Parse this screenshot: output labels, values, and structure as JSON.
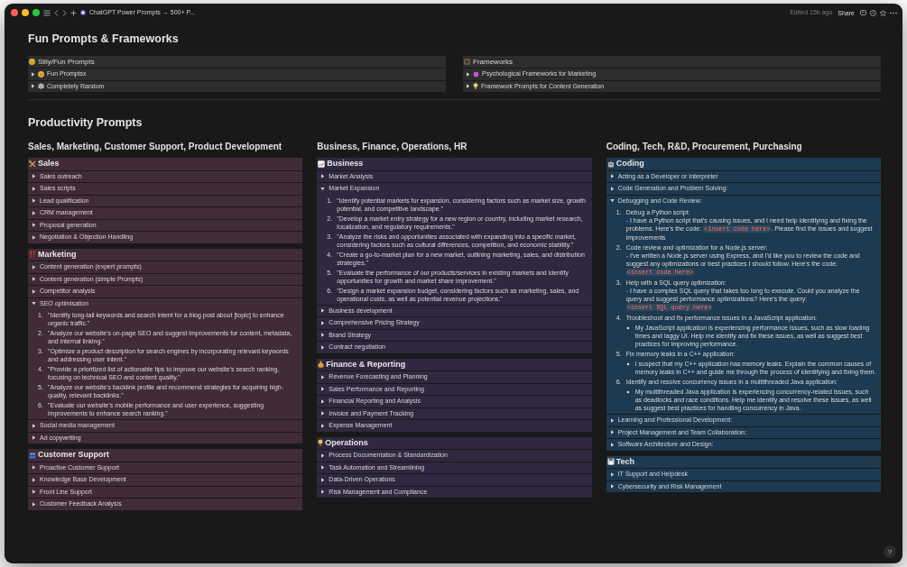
{
  "titlebar": {
    "page_title": "ChatGPT Power Prompts → 500+ P...",
    "edited": "Edited 15h ago",
    "share_label": "Share"
  },
  "fun_section": {
    "heading": "Fun Prompts & Frameworks",
    "boards": [
      {
        "title": "Silly/Fun Prompts",
        "items": [
          {
            "label": "Fun Promptsx",
            "expanded": false
          },
          {
            "label": "Completely Random",
            "expanded": false
          }
        ]
      },
      {
        "title": "Frameworks",
        "items": [
          {
            "label": "Psychological Frameworks for Marketing",
            "expanded": false
          },
          {
            "label": "Framework Prompts for Content Generation",
            "expanded": false
          }
        ]
      }
    ]
  },
  "productivity": {
    "heading": "Productivity Prompts",
    "columns": [
      {
        "heading": "Sales, Marketing, Customer Support, Product Development",
        "color": "#412b39",
        "blocks": [
          {
            "title": "Sales",
            "items": [
              {
                "label": "Sales outreach",
                "expanded": false
              },
              {
                "label": "Sales scripts",
                "expanded": false
              },
              {
                "label": "Lead qualification",
                "expanded": false
              },
              {
                "label": "CRM management",
                "expanded": false
              },
              {
                "label": "Proposal generation",
                "expanded": false
              },
              {
                "label": "Negotiation & Objection Handling",
                "expanded": false
              }
            ]
          },
          {
            "title": "Marketing",
            "items": [
              {
                "label": "Content generation (expert prompts)",
                "expanded": false
              },
              {
                "label": "Content generation (simple Prompts)",
                "expanded": false
              },
              {
                "label": "Competitor analysis",
                "expanded": false
              },
              {
                "label": "SEO optimisation",
                "expanded": true,
                "children": [
                  {
                    "number": "1.",
                    "title": "\"Identify long-tail keywords and search intent for a blog post about [topic] to enhance organic traffic.\""
                  },
                  {
                    "number": "2.",
                    "title": "\"Analyze our website's on-page SEO and suggest improvements for content, metadata, and internal linking.\""
                  },
                  {
                    "number": "3.",
                    "title": "\"Optimize a product description for search engines by incorporating relevant keywords and addressing user intent.\""
                  },
                  {
                    "number": "4.",
                    "title": "\"Provide a prioritized list of actionable tips to improve our website's search ranking, focusing on technical SEO and content quality.\""
                  },
                  {
                    "number": "5.",
                    "title": "\"Analyze our website's backlink profile and recommend strategies for acquiring high-quality, relevant backlinks.\""
                  },
                  {
                    "number": "6.",
                    "title": "\"Evaluate our website's mobile performance and user experience, suggesting improvements to enhance search ranking.\""
                  }
                ]
              },
              {
                "label": "Social media management",
                "expanded": false
              },
              {
                "label": "Ad copywriting",
                "expanded": false
              }
            ]
          },
          {
            "title": "Customer Support",
            "items": [
              {
                "label": "Proactive Customer Support",
                "expanded": false
              },
              {
                "label": "Knowledge Base Development",
                "expanded": false
              },
              {
                "label": "Front Line Support",
                "expanded": false
              },
              {
                "label": "Customer Feedback Analysis",
                "expanded": false
              }
            ]
          }
        ]
      },
      {
        "heading": "Business, Finance, Operations, HR",
        "color": "#2f2840",
        "blocks": [
          {
            "title": "Business",
            "items": [
              {
                "label": "Market Analysis",
                "expanded": false
              },
              {
                "label": "Market Expansion",
                "expanded": true,
                "children": [
                  {
                    "number": "1.",
                    "title": "\"Identify potential markets for expansion, considering factors such as market size, growth potential, and competitive landscape.\""
                  },
                  {
                    "number": "2.",
                    "title": "\"Develop a market entry strategy for a new region or country, including market research, localization, and regulatory requirements.\""
                  },
                  {
                    "number": "3.",
                    "title": "\"Analyze the risks and opportunities associated with expanding into a specific market, considering factors such as cultural differences, competition, and economic stability.\""
                  },
                  {
                    "number": "4.",
                    "title": "\"Create a go-to-market plan for a new market, outlining marketing, sales, and distribution strategies.\""
                  },
                  {
                    "number": "5.",
                    "title": "\"Evaluate the performance of our products/services in existing markets and identify opportunities for growth and market share improvement.\""
                  },
                  {
                    "number": "6.",
                    "title": "\"Design a market expansion budget, considering factors such as marketing, sales, and operational costs, as well as potential revenue projections.\""
                  }
                ]
              },
              {
                "label": "Business development",
                "expanded": false
              },
              {
                "label": "Comprehensive Pricing Strategy",
                "expanded": false
              },
              {
                "label": "Brand Strategy",
                "expanded": false
              },
              {
                "label": "Contract negotiation",
                "expanded": false
              }
            ]
          },
          {
            "title": "Finance & Reporting",
            "items": [
              {
                "label": "Revenue Forecasting and Planning",
                "expanded": false
              },
              {
                "label": "Sales Performance and Reporting",
                "expanded": false
              },
              {
                "label": "Financial Reporting and Analysis",
                "expanded": false
              },
              {
                "label": "Invoice and Payment Tracking",
                "expanded": false
              },
              {
                "label": "Expense Management",
                "expanded": false
              }
            ]
          },
          {
            "title": "Operations",
            "items": [
              {
                "label": "Process Documentation & Standardization",
                "expanded": false
              },
              {
                "label": "Task Automation and Streamlining",
                "expanded": false
              },
              {
                "label": "Data-Driven Operations",
                "expanded": false
              },
              {
                "label": "Risk Management and Compliance",
                "expanded": false
              }
            ]
          }
        ]
      },
      {
        "heading": "Coding, Tech, R&D, Procurement, Purchasing",
        "color": "#1d3a50",
        "blocks": [
          {
            "title": "Coding",
            "items": [
              {
                "label": "Acting as a Developer or Interpreter",
                "expanded": false
              },
              {
                "label": "Code Generation and Problem Solving:",
                "expanded": false
              },
              {
                "label": "Debugging and Code Review:",
                "expanded": true,
                "children": [
                  {
                    "number": "1.",
                    "title": "Debug a Python script:",
                    "body": [
                      {
                        "kind": "text",
                        "text": "- I have a Python script that's causing issues, and I need help identifying and fixing the problems. Here's the code: "
                      },
                      {
                        "kind": "code",
                        "text": "<insert code here>"
                      },
                      {
                        "kind": "text",
                        "text": ". Please find the issues and suggest improvements"
                      }
                    ]
                  },
                  {
                    "number": "2.",
                    "title": "Code review and optimization for a Node.js server:",
                    "body": [
                      {
                        "kind": "text",
                        "text": "- I've written a Node.js server using Express, and I'd like you to review the code and suggest any optimizations or best practices I should follow. Here's the code: "
                      },
                      {
                        "kind": "code",
                        "text": "<insert code here>"
                      }
                    ]
                  },
                  {
                    "number": "3.",
                    "title": "Help with a SQL query optimization:",
                    "body": [
                      {
                        "kind": "text",
                        "text": "- I have a complex SQL query that takes too long to execute. Could you analyze the query and suggest performance optimizations? Here's the query: "
                      },
                      {
                        "kind": "code",
                        "text": "<insert SQL query here>"
                      }
                    ]
                  },
                  {
                    "number": "4.",
                    "title": "Troubleshoot and fix performance issues in a JavaScript application:",
                    "bullets": [
                      "My JavaScript application is experiencing performance issues, such as slow loading times and laggy UI. Help me identify and fix these issues, as well as suggest best practices for improving performance."
                    ]
                  },
                  {
                    "number": "5.",
                    "title": "Fix memory leaks in a C++ application:",
                    "bullets": [
                      "I suspect that my C++ application has memory leaks. Explain the common causes of memory leaks in C++ and guide me through the process of identifying and fixing them."
                    ]
                  },
                  {
                    "number": "6.",
                    "title": "Identify and resolve concurrency issues in a multithreaded Java application:",
                    "bullets": [
                      "My multithreaded Java application is experiencing concurrency-related issues, such as deadlocks and race conditions. Help me identify and resolve these issues, as well as suggest best practices for handling concurrency in Java."
                    ]
                  }
                ]
              },
              {
                "label": "Learning and Professional Development:",
                "expanded": false
              },
              {
                "label": "Project Management and Team Collaboration:",
                "expanded": false
              },
              {
                "label": "Software Architecture and Design:",
                "expanded": false
              }
            ]
          },
          {
            "title": "Tech",
            "items": [
              {
                "label": "IT Support and Helpdesk",
                "expanded": false
              },
              {
                "label": "Cybersecurity and Risk Management",
                "expanded": false
              }
            ]
          }
        ]
      }
    ]
  },
  "help_button": "?"
}
